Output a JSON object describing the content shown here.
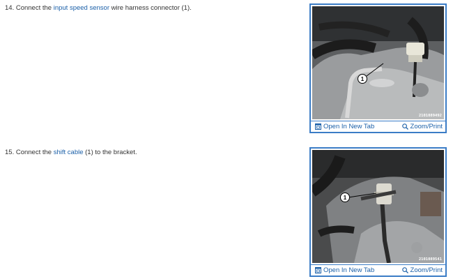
{
  "steps": [
    {
      "prefix": "14. Connect the ",
      "link": "input speed sensor",
      "suffix": " wire harness connector (1).",
      "callout": "1",
      "photo_code": "2101089492",
      "open_tab_label": "Open In New Tab",
      "zoom_label": "Zoom/Print"
    },
    {
      "prefix": "15. Connect the ",
      "link": "shift cable",
      "suffix": " (1) to the bracket.",
      "callout": "1",
      "photo_code": "2101089541",
      "open_tab_label": "Open In New Tab",
      "zoom_label": "Zoom/Print"
    }
  ],
  "colors": {
    "link": "#1a5fa8",
    "figure_border": "#3a7cc6",
    "text": "#333333"
  },
  "icons": [
    "open-tab-icon",
    "zoom-magnifier-icon"
  ]
}
